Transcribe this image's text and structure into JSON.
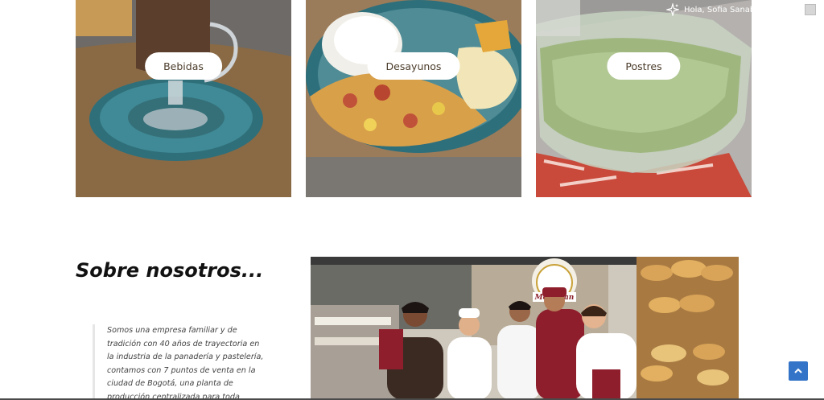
{
  "categories": [
    {
      "label": "Bebidas"
    },
    {
      "label": "Desayunos"
    },
    {
      "label": "Postres"
    }
  ],
  "admin_bar": {
    "greeting": "Hola, Sofia Sanabria Pineda"
  },
  "about": {
    "title": "Sobre nosotros...",
    "paragraph": "Somos una empresa familiar y de tradición con 40 años de trayectoria en la industria de la panadería y pastelería, contamos con 7 puntos de venta en la ciudad de Bogotá, una planta de producción centralizada para toda",
    "photo_sign": "Mettopan"
  },
  "colors": {
    "pill_text": "#4a3b2a",
    "scroll_top_button": "#3474c8"
  },
  "icons": {
    "sparkle": "sparkle-icon",
    "avatar": "avatar-icon",
    "search": "search-icon",
    "scroll_top": "chevron-up-icon"
  }
}
